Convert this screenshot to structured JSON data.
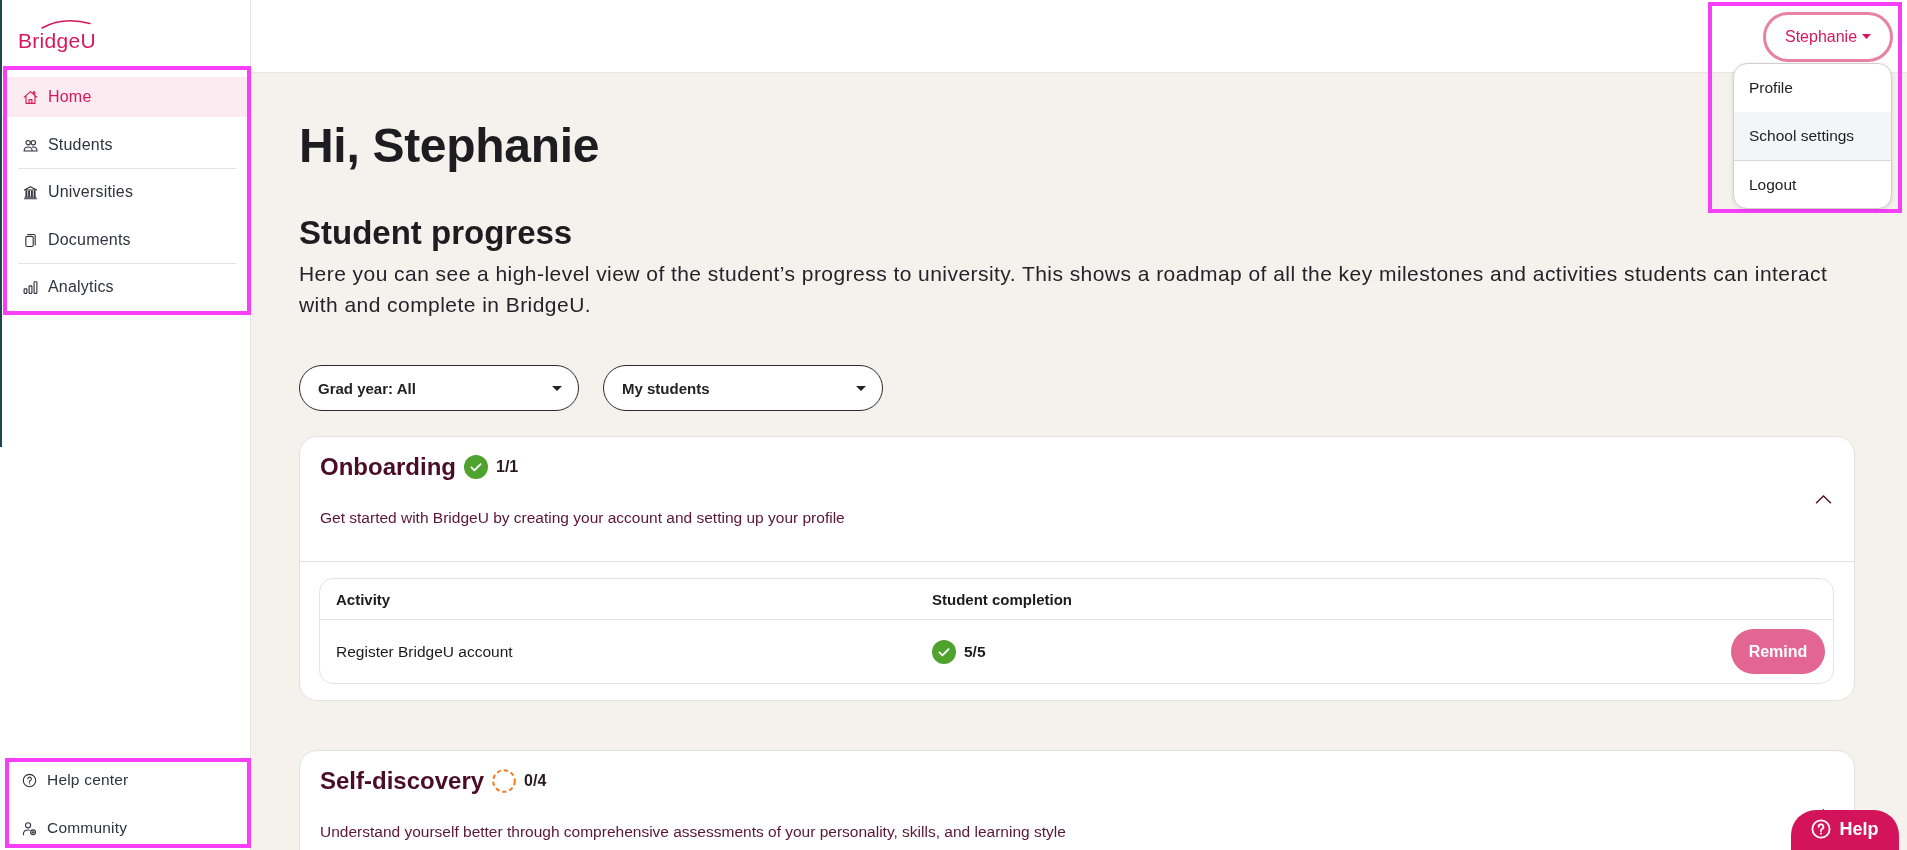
{
  "sidebar": {
    "logo": "BridgeU",
    "nav": {
      "highlighted": true,
      "groups": [
        {
          "items": [
            {
              "label": "Home",
              "selected": true
            },
            {
              "label": "Students",
              "selected": false
            }
          ]
        },
        {
          "items": [
            {
              "label": "Universities",
              "selected": false
            },
            {
              "label": "Documents",
              "selected": false
            }
          ]
        },
        {
          "items": [
            {
              "label": "Analytics",
              "selected": false
            }
          ]
        }
      ]
    },
    "footer": {
      "highlighted": true,
      "items": [
        {
          "label": "Help center"
        },
        {
          "label": "Community"
        }
      ]
    }
  },
  "header": {
    "user_menu": {
      "label": "Stephanie",
      "expanded": true,
      "highlighted": true,
      "groups": [
        {
          "items": [
            {
              "label": "Profile",
              "selected": false
            },
            {
              "label": "School settings",
              "selected": true
            }
          ]
        },
        {
          "items": [
            {
              "label": "Logout",
              "selected": false
            }
          ]
        }
      ]
    }
  },
  "main": {
    "greeting": "Hi, Stephanie",
    "section_title": "Student progress",
    "intro": "Here you can see a high-level view of the student’s progress to university. This shows a roadmap of all the key milestones and activities students can interact with and complete in BridgeU.",
    "filters": [
      {
        "label": "Grad year: All"
      },
      {
        "label": "My students"
      }
    ],
    "stages": [
      {
        "title": "Onboarding",
        "complete": true,
        "count": "1/1",
        "description": "Get started with BridgeU by creating your account and setting up your profile",
        "expanded": true,
        "table": {
          "columns": [
            "Activity",
            "Student completion"
          ],
          "rows": [
            {
              "activity": "Register BridgeU account",
              "complete": true,
              "completion": "5/5",
              "action": "Remind"
            }
          ]
        }
      },
      {
        "title": "Self-discovery",
        "complete": false,
        "count": "0/4",
        "description": "Understand yourself better through comprehensive assessments of your personality, skills, and learning style",
        "expanded": true
      }
    ]
  },
  "help_button": {
    "label": "Help"
  }
}
